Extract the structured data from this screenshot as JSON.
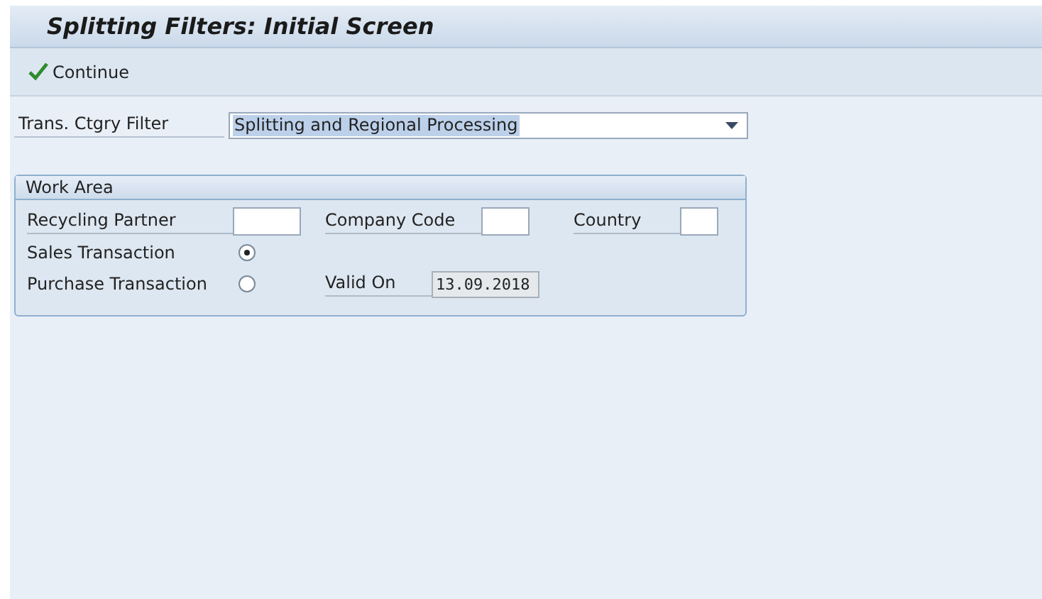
{
  "window": {
    "title": "Splitting Filters: Initial Screen"
  },
  "toolbar": {
    "buttons": [
      {
        "label": "Continue",
        "kind": "check"
      }
    ]
  },
  "filter": {
    "label": "Trans. Ctgry Filter",
    "value": "Splitting and Regional Processing",
    "text_selected": true
  },
  "work_area": {
    "title": "Work Area",
    "rows": [
      [
        {
          "kind": "input",
          "label": "Recycling Partner"
        },
        {
          "kind": "input",
          "label": "Company Code"
        },
        {
          "kind": "input",
          "label": "Country"
        }
      ],
      [
        {
          "kind": "radio",
          "label": "Sales Transaction",
          "selected": true
        }
      ],
      [
        {
          "kind": "radio",
          "label": "Purchase Transaction",
          "selected": false
        },
        {
          "kind": "display",
          "label": "Valid On",
          "value": "13.09.2018"
        }
      ]
    ]
  }
}
